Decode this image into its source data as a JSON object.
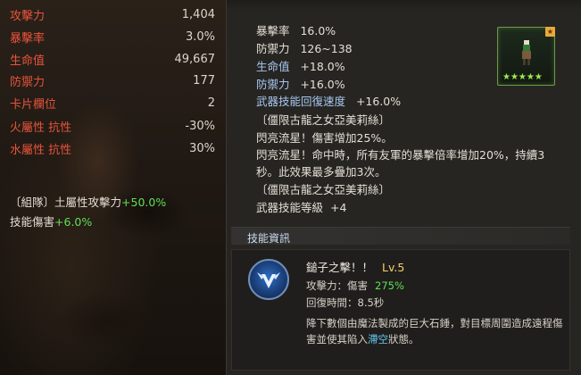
{
  "stats": [
    {
      "label": "攻擊力",
      "value": "1,404"
    },
    {
      "label": "暴擊率",
      "value": "3.0%"
    },
    {
      "label": "生命值",
      "value": "49,667"
    },
    {
      "label": "防禦力",
      "value": "177"
    },
    {
      "label": "卡片欄位",
      "value": "2"
    },
    {
      "label": "火屬性 抗性",
      "value": "-30%"
    },
    {
      "label": "水屬性 抗性",
      "value": "30%"
    }
  ],
  "bonuses": {
    "party": {
      "label": "〔組隊〕土屬性攻擊力",
      "value": "+50.0%"
    },
    "skill_damage": {
      "label": "技能傷害",
      "value": "+6.0%"
    }
  },
  "item": {
    "lines": {
      "crit": {
        "label": "暴擊率",
        "value": "16.0%"
      },
      "def_range": {
        "label": "防禦力",
        "value": "126~138"
      },
      "hp": {
        "label": "生命值",
        "value": "+18.0%"
      },
      "def_pct": {
        "label": "防禦力",
        "value": "+16.0%"
      },
      "ws_cd": {
        "label": "武器技能回復速度",
        "value": "+16.0%"
      },
      "set1": "〔僵限古龍之女亞美莉絲〕",
      "effect1": "閃亮流星！傷害增加25%。",
      "effect2a": "閃亮流星！命中時，所有友軍的暴擊倍率增加20%，持續3",
      "effect2b": "秒。此效果最多疊加3次。",
      "set2": "〔僵限古龍之女亞美莉絲〕",
      "ws_level": {
        "label": "武器技能等級",
        "value": "+4"
      }
    },
    "badge": "★",
    "stars": "★★★★★"
  },
  "skill_info": {
    "header": "技能資訊",
    "name": "鎚子之擊！！",
    "level": "Lv.5",
    "attack_label": "攻擊力：傷害",
    "attack_value": "275%",
    "cooldown": "回復時間：8.5秒",
    "desc1": "降下數個由魔法製成的巨大石錘，對目標周圍造成遠程傷",
    "desc2a": "害並使其陷入",
    "desc2_hl": "滯空",
    "desc2b": "狀態。"
  },
  "colors": {
    "stat_label": "#e8543c",
    "green": "#5ee055",
    "blue_label": "#a8c6f0",
    "level_gold": "#f4d26a"
  }
}
